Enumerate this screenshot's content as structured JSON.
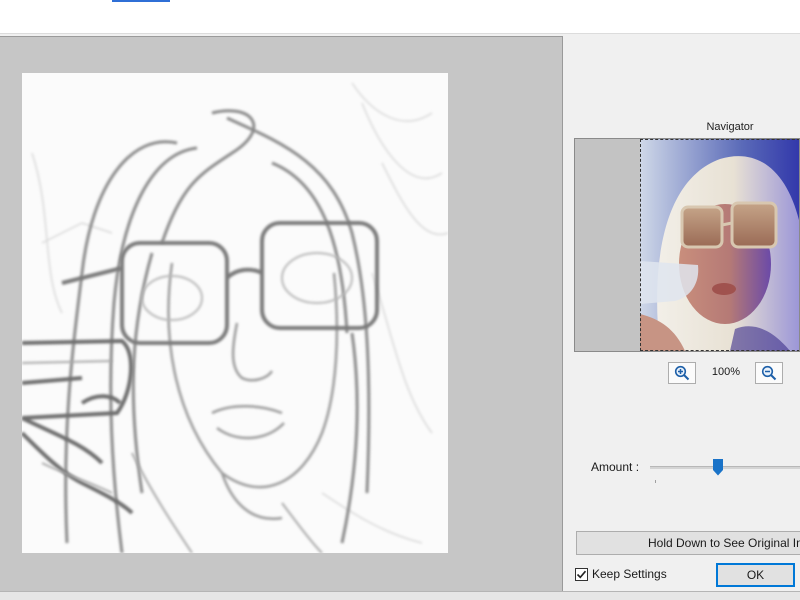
{
  "navigator": {
    "label": "Navigator",
    "zoom_level": "100%"
  },
  "controls": {
    "amount_label": "Amount :",
    "amount_level": 0.45,
    "hold_button_label": "Hold Down to See Original Ima",
    "keep_settings_label": "Keep Settings",
    "keep_settings_checked": true,
    "ok_label": "OK"
  },
  "icons": {
    "zoom_in": "zoom-in-icon",
    "zoom_out": "zoom-out-icon",
    "check": "checkmark-icon"
  },
  "colors": {
    "accent": "#0078d7",
    "slider_thumb": "#1a73c8",
    "panel_gray": "#c6c6c6"
  }
}
